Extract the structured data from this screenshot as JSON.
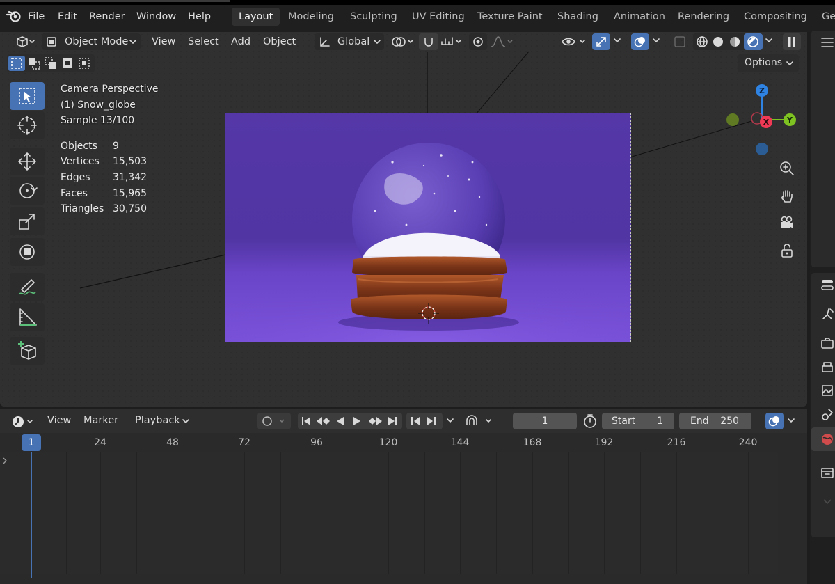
{
  "menu": {
    "items": [
      "File",
      "Edit",
      "Render",
      "Window",
      "Help"
    ]
  },
  "workspaces": {
    "tabs": [
      "Layout",
      "Modeling",
      "Sculpting",
      "UV Editing",
      "Texture Paint",
      "Shading",
      "Animation",
      "Rendering",
      "Compositing",
      "Ge"
    ],
    "active": "Layout"
  },
  "viewport_header": {
    "mode": "Object Mode",
    "view": "View",
    "select": "Select",
    "add": "Add",
    "object": "Object",
    "orientation": "Global",
    "options": "Options"
  },
  "overlay": {
    "camera": "Camera Perspective",
    "object": "(1) Snow_globe",
    "sample": "Sample 13/100"
  },
  "stats": [
    {
      "label": "Objects",
      "value": "9"
    },
    {
      "label": "Vertices",
      "value": "15,503"
    },
    {
      "label": "Edges",
      "value": "31,342"
    },
    {
      "label": "Faces",
      "value": "15,965"
    },
    {
      "label": "Triangles",
      "value": "30,750"
    }
  ],
  "gizmo": {
    "z": "Z",
    "x": "X",
    "y": "Y"
  },
  "timeline": {
    "view": "View",
    "marker": "Marker",
    "playback": "Playback",
    "current_frame": "1",
    "start_label": "Start",
    "start_value": "1",
    "end_label": "End",
    "end_value": "250",
    "ruler": [
      "1",
      "24",
      "48",
      "72",
      "96",
      "120",
      "144",
      "168",
      "192",
      "216",
      "240"
    ]
  },
  "colors": {
    "accent": "#4772b3",
    "gizmo_x": "#f03a55",
    "gizmo_y": "#7ec221",
    "gizmo_z": "#2f83e3"
  }
}
